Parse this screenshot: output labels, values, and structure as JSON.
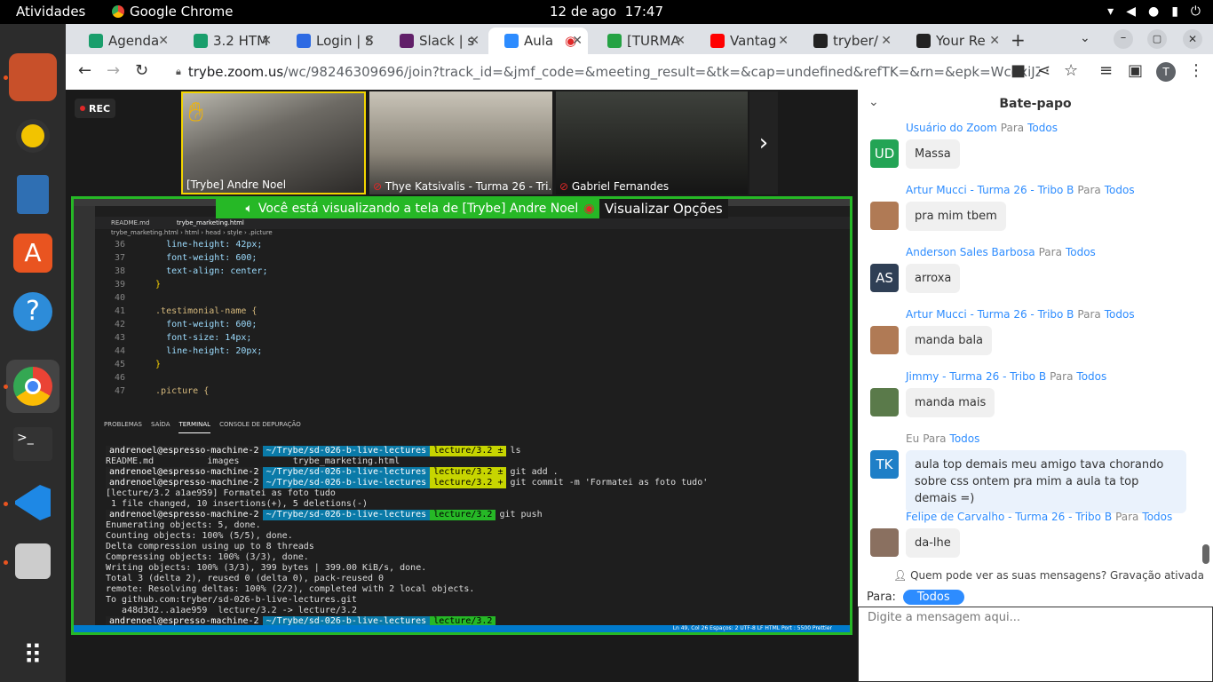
{
  "topbar": {
    "activities": "Atividades",
    "app_name": "Google Chrome",
    "date": "12 de ago",
    "time": "17:47"
  },
  "tabs": [
    {
      "label": "Agenda",
      "color": "#1a9e6c"
    },
    {
      "label": "3.2 HTM",
      "color": "#1a9e6c"
    },
    {
      "label": "Login | S",
      "color": "#2d6ae3"
    },
    {
      "label": "Slack | s",
      "color": "#611f69"
    },
    {
      "label": "Aula",
      "color": "#2d8cff"
    },
    {
      "label": "[TURMA",
      "color": "#25a244"
    },
    {
      "label": "Vantag",
      "color": "#ff0000"
    },
    {
      "label": "tryber/",
      "color": "#222222"
    },
    {
      "label": "Your Re",
      "color": "#222222"
    }
  ],
  "url": {
    "host": "trybe.zoom.us",
    "path": "/wc/98246309696/join?track_id=&jmf_code=&meeting_result=&tk=&cap=undefined&refTK=&rn=&epk=WcdxiJZBUHhOpAz_af..."
  },
  "profile_initial": "T",
  "rec": "REC",
  "videos": [
    {
      "name": "[Trybe] Andre Noel"
    },
    {
      "name": "Thye Katsivalis - Turma 26 - Tri..."
    },
    {
      "name": "Gabriel Fernandes"
    }
  ],
  "share": {
    "banner": "Você está visualizando a tela de [Trybe] Andre Noel",
    "view_options": "Visualizar Opções"
  },
  "editor": {
    "tab1": "README.md",
    "tab2": "trybe_marketing.html",
    "breadcrumb": "trybe_marketing.html › html › head › style › .picture",
    "code": [
      {
        "n": "36",
        "t": "    line-height: 42px;"
      },
      {
        "n": "37",
        "t": "    font-weight: 600;"
      },
      {
        "n": "38",
        "t": "    text-align: center;"
      },
      {
        "n": "39",
        "t": "  }"
      },
      {
        "n": "40",
        "t": ""
      },
      {
        "n": "41",
        "t": "  .testimonial-name {"
      },
      {
        "n": "42",
        "t": "    font-weight: 600;"
      },
      {
        "n": "43",
        "t": "    font-size: 14px;"
      },
      {
        "n": "44",
        "t": "    line-height: 20px;"
      },
      {
        "n": "45",
        "t": "  }"
      },
      {
        "n": "46",
        "t": ""
      },
      {
        "n": "47",
        "t": "  .picture {"
      }
    ],
    "terminal_tabs": [
      "PROBLEMAS",
      "SAÍDA",
      "TERMINAL",
      "CONSOLE DE DEPURAÇÃO"
    ],
    "terminal": [
      {
        "u": "andrenoel@espresso-machine-2",
        "p": "~/Trybe/sd-026-b-live-lectures",
        "b": "lecture/3.2 ±",
        "c": "ls",
        "dirty": true
      },
      {
        "t": "README.md          images          trybe_marketing.html"
      },
      {
        "u": "andrenoel@espresso-machine-2",
        "p": "~/Trybe/sd-026-b-live-lectures",
        "b": "lecture/3.2 ±",
        "c": "git add .",
        "dirty": true
      },
      {
        "u": "andrenoel@espresso-machine-2",
        "p": "~/Trybe/sd-026-b-live-lectures",
        "b": "lecture/3.2 +",
        "c": "git commit -m 'Formatei as foto tudo'",
        "dirty": true
      },
      {
        "t": "[lecture/3.2 a1ae959] Formatei as foto tudo"
      },
      {
        "t": " 1 file changed, 10 insertions(+), 5 deletions(-)"
      },
      {
        "u": "andrenoel@espresso-machine-2",
        "p": "~/Trybe/sd-026-b-live-lectures",
        "b": "lecture/3.2",
        "c": "git push",
        "dirty": false
      },
      {
        "t": "Enumerating objects: 5, done."
      },
      {
        "t": "Counting objects: 100% (5/5), done."
      },
      {
        "t": "Delta compression using up to 8 threads"
      },
      {
        "t": "Compressing objects: 100% (3/3), done."
      },
      {
        "t": "Writing objects: 100% (3/3), 399 bytes | 399.00 KiB/s, done."
      },
      {
        "t": "Total 3 (delta 2), reused 0 (delta 0), pack-reused 0"
      },
      {
        "t": "remote: Resolving deltas: 100% (2/2), completed with 2 local objects."
      },
      {
        "t": "To github.com:tryber/sd-026-b-live-lectures.git"
      },
      {
        "t": "   a48d3d2..a1ae959  lecture/3.2 -> lecture/3.2"
      },
      {
        "u": "andrenoel@espresso-machine-2",
        "p": "~/Trybe/sd-026-b-live-lectures",
        "b": "lecture/3.2",
        "c": "",
        "dirty": false
      }
    ],
    "status": "Ln 49, Col 26   Espaços: 2   UTF-8   LF   HTML   Port : 5500   Prettier"
  },
  "chat": {
    "title": "Bate-papo",
    "to_word": "Para",
    "messages": [
      {
        "from": "Usuário do Zoom",
        "to": "Todos",
        "text": "Massa",
        "avatar": "UD",
        "color": "#23a455"
      },
      {
        "from": "Artur Mucci - Turma 26 - Tribo B",
        "to": "Todos",
        "text": "pra mim tbem",
        "avatar": "",
        "color": "#b07a55"
      },
      {
        "from": "Anderson Sales Barbosa",
        "to": "Todos",
        "text": "arroxa",
        "avatar": "AS",
        "color": "#2f3f55"
      },
      {
        "from": "Artur Mucci - Turma 26 - Tribo B",
        "to": "Todos",
        "text": "manda bala",
        "avatar": "",
        "color": "#b07a55"
      },
      {
        "from": "Jimmy - Turma 26 - Tribo B",
        "to": "Todos",
        "text": "manda mais",
        "avatar": "",
        "color": "#5a7a4a"
      },
      {
        "from": "Eu",
        "to": "Todos",
        "text": "aula top demais meu amigo tava chorando sobre css ontem pra mim a aula ta top demais =)",
        "avatar": "TK",
        "color": "#1f7fc7",
        "me": true
      },
      {
        "from": "Felipe de Carvalho - Turma 26 - Tribo B",
        "to": "Todos",
        "text": "da-lhe",
        "avatar": "",
        "color": "#8a7060"
      }
    ],
    "privacy": "Quem pode ver as suas mensagens? Gravação ativada",
    "para_label": "Para:",
    "para_value": "Todos",
    "placeholder": "Digite a mensagem aqui..."
  }
}
